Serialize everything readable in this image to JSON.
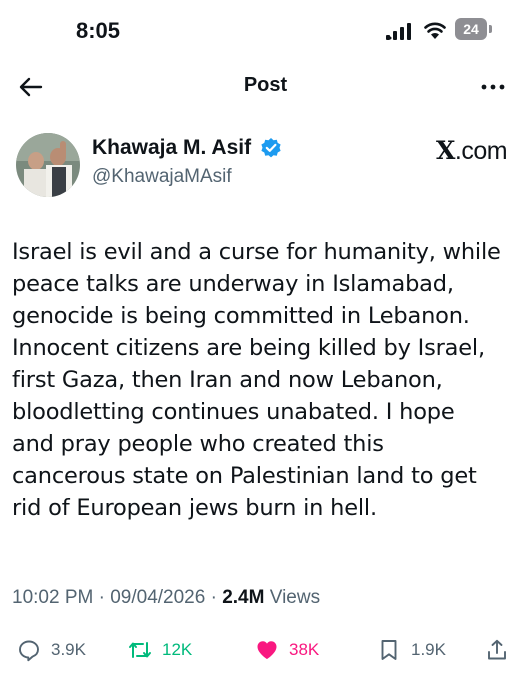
{
  "status_bar": {
    "time": "8:05",
    "battery_level": "24",
    "icons": [
      "signal-icon",
      "wifi-icon",
      "battery-icon"
    ]
  },
  "nav": {
    "title": "Post",
    "back_icon": "back-arrow-icon",
    "more_icon": "more-icon"
  },
  "author": {
    "name": "Khawaja M. Asif",
    "handle": "@KhawajaMAsif",
    "verified": true,
    "verified_color": "#1d9bf0"
  },
  "source_badge": {
    "prefix": "X",
    "suffix": ".com"
  },
  "tweet": {
    "lines": [
      "Israel is evil and a curse for humanity, while",
      "peace talks are underway in Islamabad,",
      "genocide is being committed in Lebanon.",
      "Innocent citizens are being killed by Israel,",
      "first Gaza, then Iran and now Lebanon,",
      "bloodletting continues unabated. I hope",
      "and pray people who created this",
      "cancerous state on Palestinian land to get",
      "rid of European jews burn in hell."
    ]
  },
  "meta": {
    "time": "10:02 PM",
    "separator": "·",
    "date": "09/04/2026",
    "views_count": "2.4M",
    "views_label": "Views"
  },
  "actions": {
    "reply_count": "3.9K",
    "repost_count": "12K",
    "like_count": "38K",
    "bookmark_count": "1.9K"
  },
  "colors": {
    "text": "#0f1419",
    "secondary": "#536471",
    "repost": "#00ba7c",
    "like": "#f91880"
  }
}
